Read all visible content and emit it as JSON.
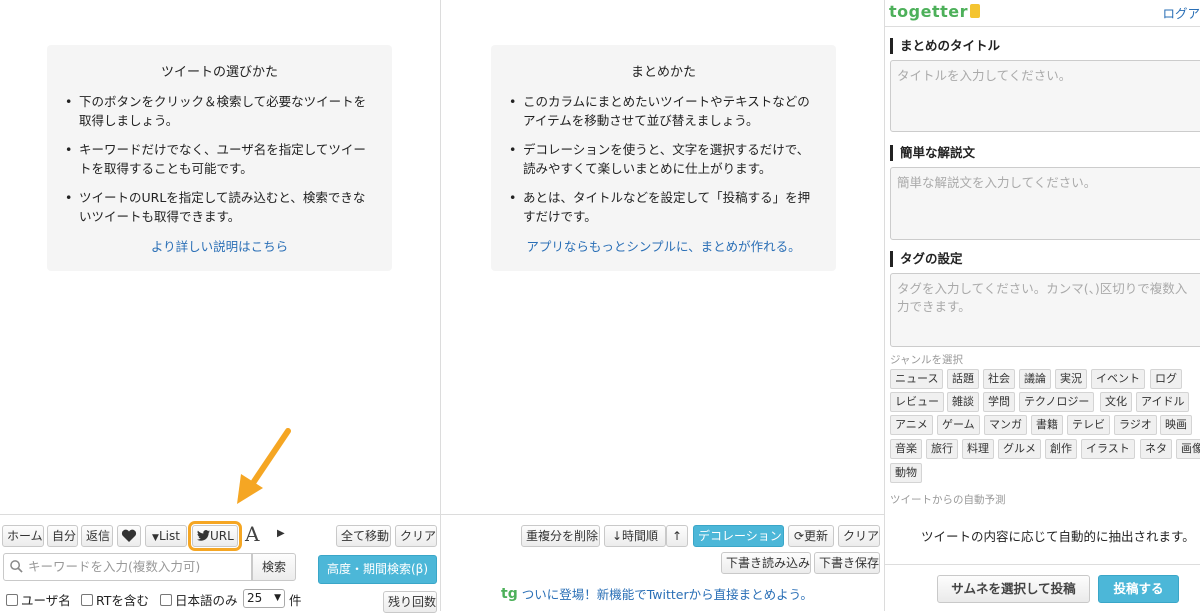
{
  "left": {
    "guide": {
      "title": "ツイートの選びかた",
      "items": [
        "下のボタンをクリック＆検索して必要なツイートを取得しましょう。",
        "キーワードだけでなく、ユーザ名を指定してツイートを取得することも可能です。",
        "ツイートのURLを指定して読み込むと、検索できないツイートも取得できます。"
      ],
      "link": "より詳しい説明はこちら"
    },
    "toolbar": {
      "home": "ホーム",
      "self": "自分",
      "reply": "返信",
      "list": "List",
      "url": "URL",
      "font": "A",
      "move_all": "全て移動",
      "clear": "クリア"
    },
    "search": {
      "placeholder": "キーワードを入力(複数入力可)",
      "button": "検索",
      "advanced": "高度・期間検索(β)"
    },
    "options": {
      "user": "ユーザ名",
      "rt": "RTを含む",
      "japanese": "日本語のみ",
      "count_value": "25",
      "count_unit": "件",
      "remaining": "残り回数"
    }
  },
  "middle": {
    "guide": {
      "title": "まとめかた",
      "items": [
        "このカラムにまとめたいツイートやテキストなどのアイテムを移動させて並び替えましょう。",
        "デコレーションを使うと、文字を選択するだけで、読みやすくて楽しいまとめに仕上がります。",
        "あとは、タイトルなどを設定して「投稿する」を押すだけです。"
      ],
      "link": "アプリならもっとシンプルに、まとめが作れる。"
    },
    "toolbar": {
      "dedupe": "重複分を削除",
      "time_order": "時間順",
      "decoration": "デコレーション",
      "refresh": "更新",
      "clear": "クリア",
      "load_draft": "下書き読み込み",
      "save_draft": "下書き保存"
    },
    "promo": "ついに登場！新機能でTwitterから直接まとめよう。"
  },
  "right": {
    "logo": "togetter",
    "login": "ログア",
    "title_label": "まとめのタイトル",
    "title_placeholder": "タイトルを入力してください。",
    "desc_label": "簡単な解説文",
    "desc_placeholder": "簡単な解説文を入力してください。",
    "tag_label": "タグの設定",
    "tag_placeholder": "タグを入力してください。カンマ(、)区切りで複数入力できます。",
    "genre_label": "ジャンルを選択",
    "genres": [
      [
        "ニュース",
        "話題",
        "社会",
        "議論",
        "実況",
        "イベント",
        "ログ"
      ],
      [
        "レビュー",
        "雑談",
        "学問",
        "テクノロジー",
        "文化",
        "アイドル"
      ],
      [
        "アニメ",
        "ゲーム",
        "マンガ",
        "書籍",
        "テレビ",
        "ラジオ",
        "映画"
      ],
      [
        "音楽",
        "旅行",
        "料理",
        "グルメ",
        "創作",
        "イラスト",
        "ネタ",
        "画像"
      ],
      [
        "動物"
      ]
    ],
    "auto_label": "ツイートからの自動予測",
    "auto_text": "ツイートの内容に応じて自動的に抽出されます。",
    "post_thumb": "サムネを選択して投稿",
    "post": "投稿する"
  },
  "colors": {
    "accent_blue": "#4cb7d8",
    "link": "#2a6fb6",
    "highlight": "#f5a623",
    "logo_green": "#4db05a"
  }
}
